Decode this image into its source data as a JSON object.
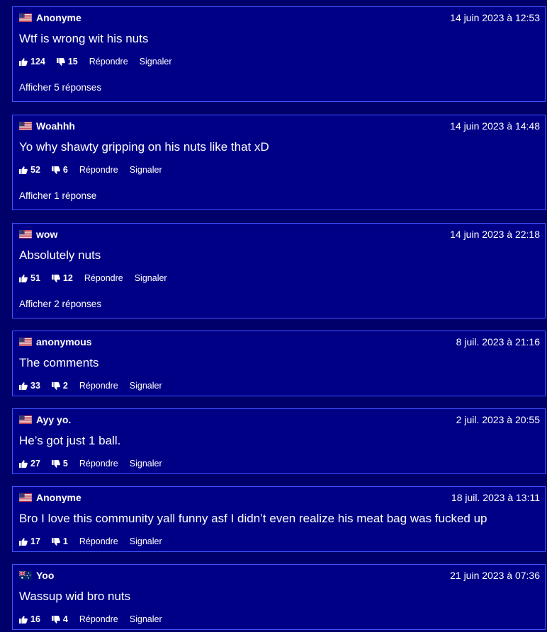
{
  "labels": {
    "reply": "Répondre",
    "report": "Signaler"
  },
  "colors": {
    "page_background": "#00006b",
    "card_background": "#000087",
    "card_border": "#3f53ff",
    "text": "#ffffff"
  },
  "comments": [
    {
      "flag": "us-flag",
      "author": "Anonyme",
      "date": "14 juin 2023 à 12:53",
      "text": "Wtf is wrong wit his nuts",
      "likes": "124",
      "dislikes": "15",
      "replies": "Afficher 5 réponses"
    },
    {
      "flag": "us-flag",
      "author": "Woahhh",
      "date": "14 juin 2023 à 14:48",
      "text": "Yo why shawty gripping on his nuts like that xD",
      "likes": "52",
      "dislikes": "6",
      "replies": "Afficher 1 réponse"
    },
    {
      "flag": "us-flag",
      "author": "wow",
      "date": "14 juin 2023 à 22:18",
      "text": "Absolutely nuts",
      "likes": "51",
      "dislikes": "12",
      "replies": "Afficher 2 réponses"
    },
    {
      "flag": "us-flag",
      "author": "anonymous",
      "date": "8 juil. 2023 à 21:16",
      "text": "The comments",
      "likes": "33",
      "dislikes": "2"
    },
    {
      "flag": "us-flag",
      "author": "Ayy yo.",
      "date": "2 juil. 2023 à 20:55",
      "text": "He’s got just 1 ball.",
      "likes": "27",
      "dislikes": "5"
    },
    {
      "flag": "us-flag",
      "author": "Anonyme",
      "date": "18 juil. 2023 à 13:11",
      "text": "Bro I love this community yall funny asf I didn’t even realize his meat bag was fucked up",
      "likes": "17",
      "dislikes": "1"
    },
    {
      "flag": "au-flag",
      "author": "Yoo",
      "date": "21 juin 2023 à 07:36",
      "text": "Wassup wid bro nuts",
      "likes": "16",
      "dislikes": "4"
    }
  ]
}
